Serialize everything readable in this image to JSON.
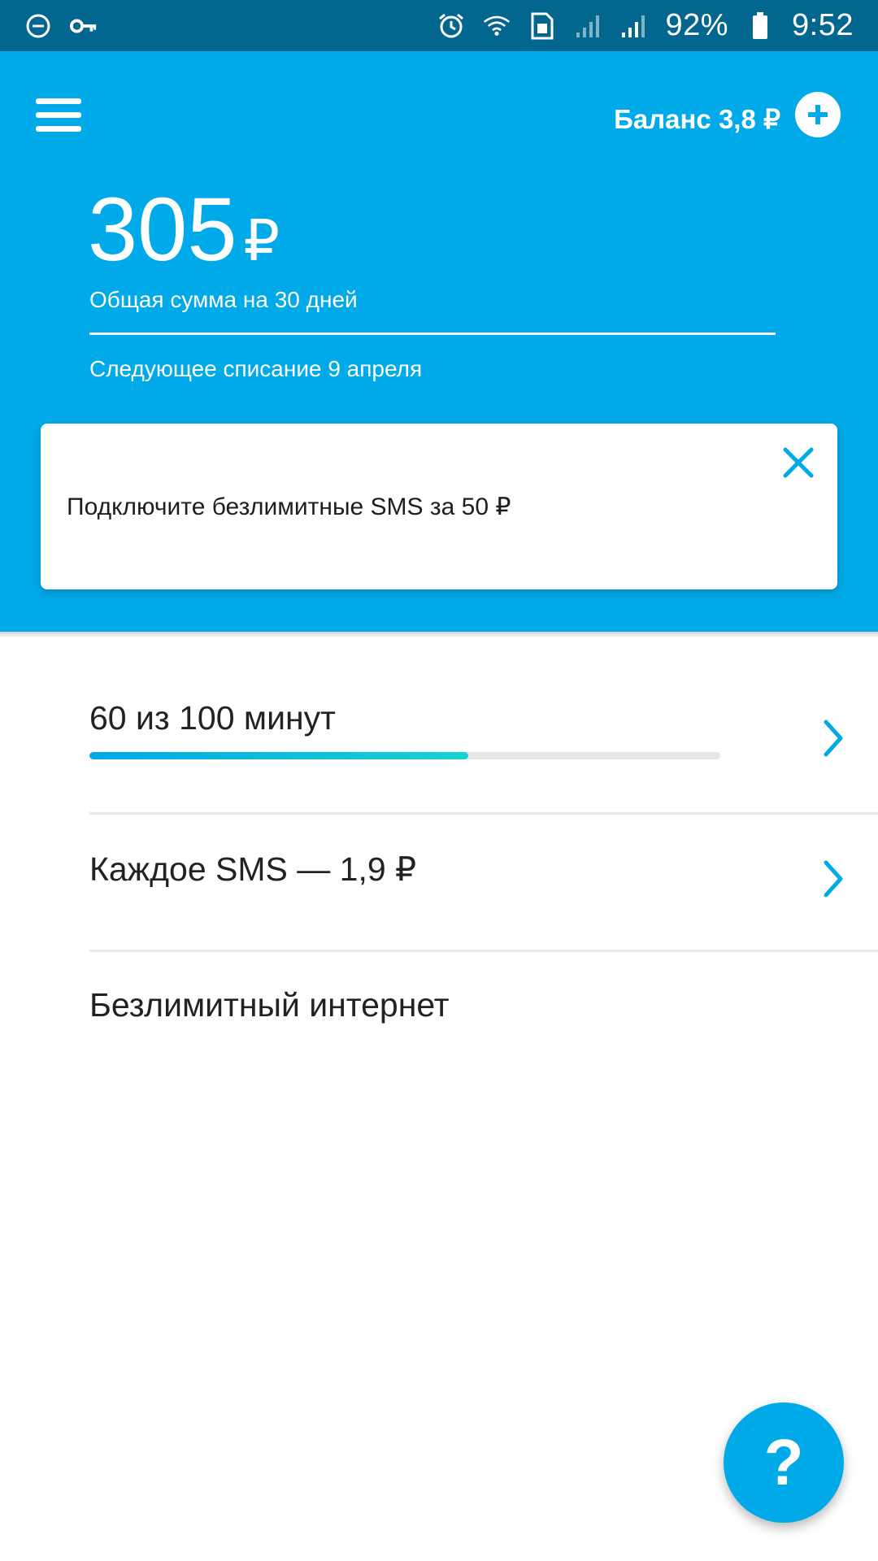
{
  "status_bar": {
    "battery": "92%",
    "time": "9:52",
    "icons": [
      "do-not-disturb-icon",
      "key-icon",
      "alarm-icon",
      "wifi-icon",
      "sim-icon",
      "signal-icon",
      "signal-icon",
      "battery-icon"
    ]
  },
  "header": {
    "balance_label": "Баланс 3,8 ₽",
    "amount": "305",
    "currency": "₽",
    "amount_caption": "Общая сумма на 30 дней",
    "next_charge": "Следующее списание 9 апреля"
  },
  "promo": {
    "text": "Подключите безлимитные SMS за 50 ₽"
  },
  "items": [
    {
      "title": "60 из 100 минут",
      "progress": 0.6
    },
    {
      "title": "Каждое SMS — 1,9 ₽"
    },
    {
      "title": "Безлимитный интернет"
    }
  ],
  "help_fab": {
    "label": "?"
  },
  "colors": {
    "accent": "#00a9e8",
    "status_bar": "#03668f",
    "progress_end": "#18d2d0"
  }
}
